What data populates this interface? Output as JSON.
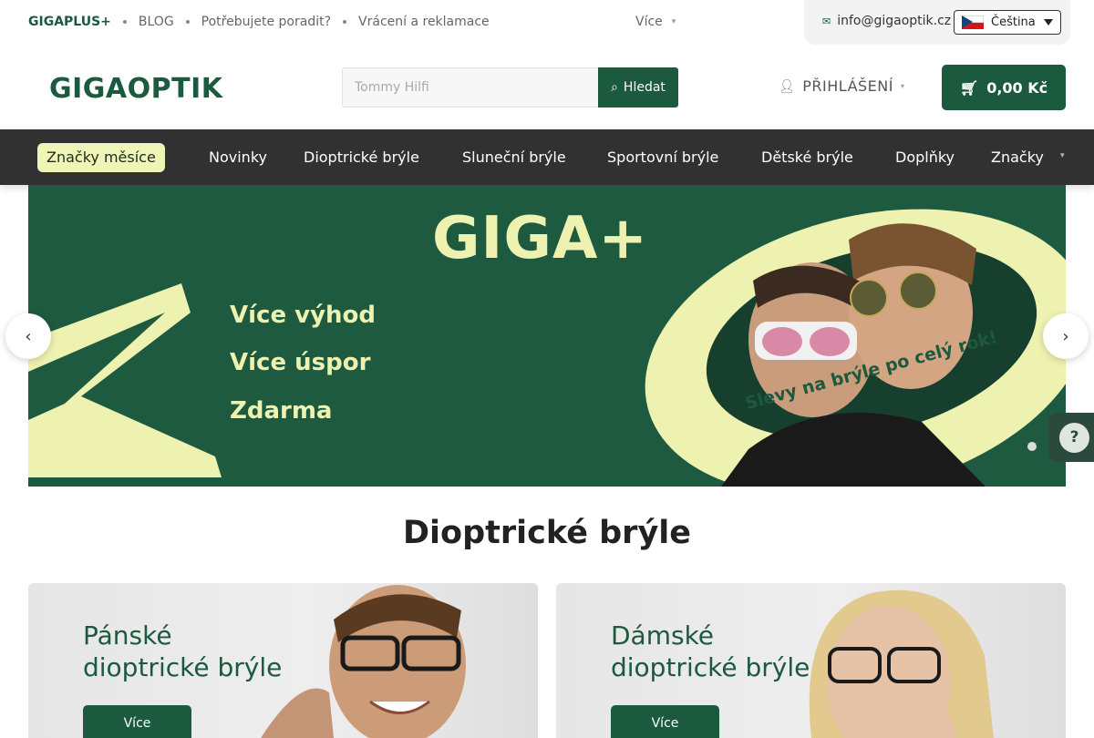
{
  "topbar": {
    "links": [
      "GIGAPLUS+",
      "BLOG",
      "Potřebujete poradit?",
      "Vrácení a reklamace"
    ],
    "more_label": "Více",
    "email": "info@gigaoptik.cz",
    "language": "Čeština"
  },
  "header": {
    "logo_text": "GIGAOPTIK",
    "search_placeholder": "Tommy Hilfi",
    "search_button": "Hledat",
    "login_label": "PŘIHLÁŠENÍ",
    "cart_total": "0,00 Kč"
  },
  "nav": {
    "items": [
      "Značky měsíce",
      "Novinky",
      "Dioptrické brýle",
      "Sluneční brýle",
      "Sportovní brýle",
      "Dětské brýle",
      "Doplňky",
      "Značky"
    ]
  },
  "hero": {
    "title": "GIGA+",
    "lines": [
      "Více výhod",
      "Více úspor",
      "Zdarma"
    ],
    "ring_text": "Slevy na brýle po celý rok!"
  },
  "section": {
    "title": "Dioptrické brýle",
    "cards": [
      {
        "title_line1": "Pánské",
        "title_line2": "dioptrické brýle",
        "button": "Více"
      },
      {
        "title_line1": "Dámské",
        "title_line2": "dioptrické brýle",
        "button": "Více"
      }
    ]
  },
  "help_button": "?",
  "colors": {
    "brand_green": "#1c5a3f",
    "nav_dark": "#313131",
    "accent_lime": "#eef2b0"
  }
}
